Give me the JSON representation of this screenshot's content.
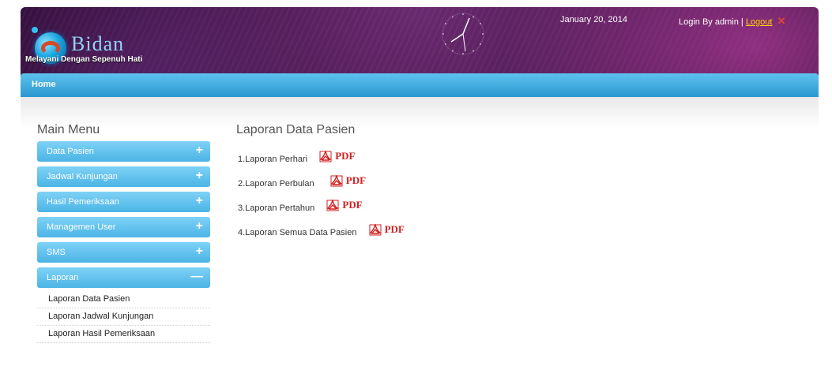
{
  "header": {
    "app_title": "Bidan",
    "tagline": "Melayani Dengan Sepenuh Hati",
    "date": "January 20, 2014",
    "login_text": "Login By admin |",
    "logout_label": "Logout"
  },
  "nav": {
    "home_label": "Home"
  },
  "sidebar": {
    "title": "Main Menu",
    "items": [
      {
        "label": "Data Pasien",
        "sign": "+"
      },
      {
        "label": "Jadwal Kunjungan",
        "sign": "+"
      },
      {
        "label": "Hasil Pemeriksaan",
        "sign": "+"
      },
      {
        "label": "Managemen User",
        "sign": "+"
      },
      {
        "label": "SMS",
        "sign": "+"
      },
      {
        "label": "Laporan",
        "sign": "—"
      }
    ],
    "sub_items": [
      {
        "label": "Laporan Data Pasien"
      },
      {
        "label": "Laporan Jadwal Kunjungan"
      },
      {
        "label": "Laporan Hasil Pemeriksaan"
      }
    ]
  },
  "main": {
    "title": "Laporan Data Pasien",
    "reports": [
      {
        "label": "1.Laporan Perhari",
        "pdf_label": "PDF"
      },
      {
        "label": "2.Laporan Perbulan",
        "pdf_label": "PDF"
      },
      {
        "label": "3.Laporan Pertahun",
        "pdf_label": "PDF"
      },
      {
        "label": "4.Laporan Semua Data Pasien",
        "pdf_label": "PDF"
      }
    ]
  },
  "colors": {
    "header_bg": "#3d1245",
    "nav_bar": "#3aa8dc",
    "menu_item": "#5ec0ec",
    "pdf_red": "#d21f1f",
    "logout_link": "#ffd400"
  },
  "icons": {
    "pdf": "pdf-icon",
    "logout": "close-icon",
    "logo": "logo-icon",
    "clock": "clock-icon"
  }
}
